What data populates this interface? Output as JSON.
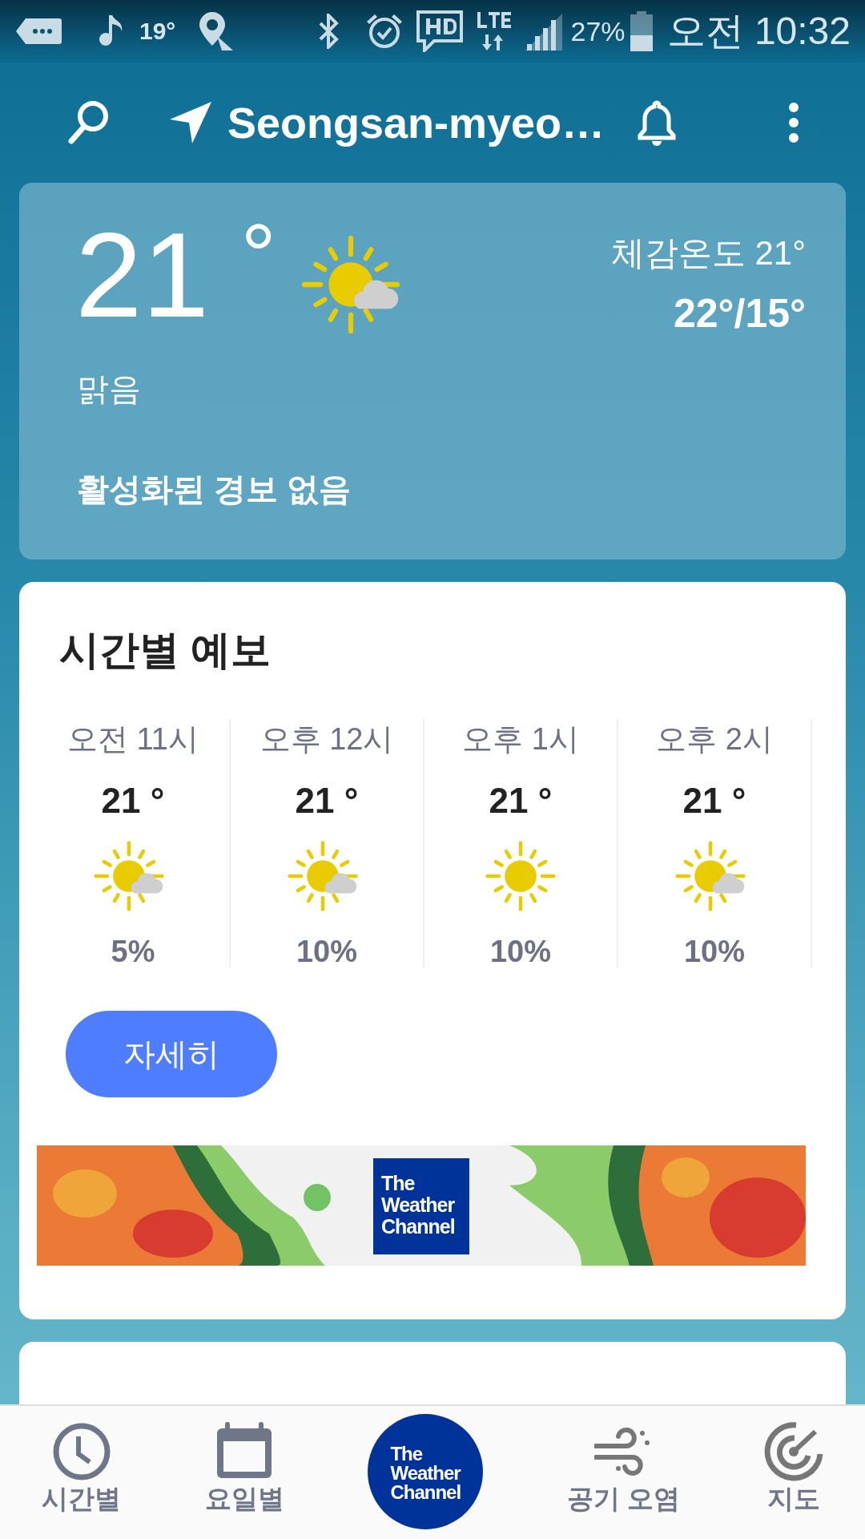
{
  "status_bar": {
    "temperature": "19°",
    "battery_percent": "27%",
    "time": "오전 10:32"
  },
  "header": {
    "location": "Seongsan-myeo…"
  },
  "current": {
    "temperature": "21",
    "degree": "°",
    "kind": "partly_cloudy",
    "condition": "맑음",
    "feels_like": "체감온도 21°",
    "high_low": "22°/15°",
    "alerts": "활성화된 경보 없음"
  },
  "hourly": {
    "title": "시간별 예보",
    "items": [
      {
        "time": "오전 11시",
        "temperature": "21 °",
        "kind": "partly_cloudy",
        "precip": "5%"
      },
      {
        "time": "오후 12시",
        "temperature": "21 °",
        "kind": "partly_cloudy",
        "precip": "10%"
      },
      {
        "time": "오후 1시",
        "temperature": "21 °",
        "kind": "sunny",
        "precip": "10%"
      },
      {
        "time": "오후 2시",
        "temperature": "21 °",
        "kind": "partly_cloudy",
        "precip": "10%"
      }
    ],
    "button": "자세히",
    "banner": {
      "kind": "picture",
      "logo": [
        "The",
        "Weather",
        "Channel"
      ]
    }
  },
  "bottom_nav": [
    {
      "kind": "clock",
      "label": "시간별",
      "selected": false
    },
    {
      "kind": "calendar",
      "label": "요일별",
      "selected": false
    },
    {
      "kind": "logo",
      "logo": [
        "The",
        "Weather",
        "Channel"
      ]
    },
    {
      "kind": "wind",
      "label": "공기 오염",
      "selected": false
    },
    {
      "kind": "radar",
      "label": "지도",
      "selected": false
    }
  ]
}
